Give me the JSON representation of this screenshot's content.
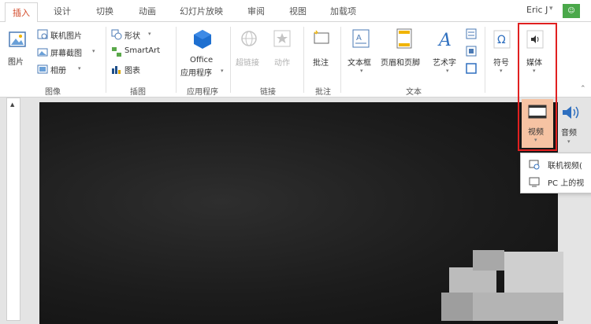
{
  "tabs": [
    {
      "label": "插入",
      "active": true
    },
    {
      "label": "设计",
      "active": false
    },
    {
      "label": "切换",
      "active": false
    },
    {
      "label": "动画",
      "active": false
    },
    {
      "label": "幻灯片放映",
      "active": false
    },
    {
      "label": "审阅",
      "active": false
    },
    {
      "label": "视图",
      "active": false
    },
    {
      "label": "加载项",
      "active": false
    }
  ],
  "user": {
    "name": "Eric J",
    "avatar_text": "☺"
  },
  "ribbon": {
    "images": {
      "group_label": "图像",
      "picture": "图片",
      "online_picture": "联机图片",
      "screenshot": "屏幕截图",
      "album": "相册"
    },
    "illustrations": {
      "group_label": "插图",
      "shapes": "形状",
      "smartart": "SmartArt",
      "chart": "图表"
    },
    "apps": {
      "group_label": "应用程序",
      "office_line1": "Office",
      "office_line2": "应用程序"
    },
    "links": {
      "group_label": "链接",
      "hyperlink": "超链接",
      "action": "动作"
    },
    "comments": {
      "group_label": "批注",
      "comment": "批注"
    },
    "text": {
      "group_label": "文本",
      "textbox": "文本框",
      "header_footer": "页眉和页脚",
      "wordart": "艺术字"
    },
    "symbols": {
      "symbol": "符号"
    },
    "media": {
      "media": "媒体",
      "video": "视频",
      "audio": "音频"
    }
  },
  "video_menu": {
    "items": [
      "联机视频(",
      "PC 上的视"
    ]
  },
  "colors": {
    "active_tab": "#d24726",
    "highlight": "#e02020",
    "video_selected": "#f6c3a3",
    "office_blue": "#1e6fd0"
  }
}
